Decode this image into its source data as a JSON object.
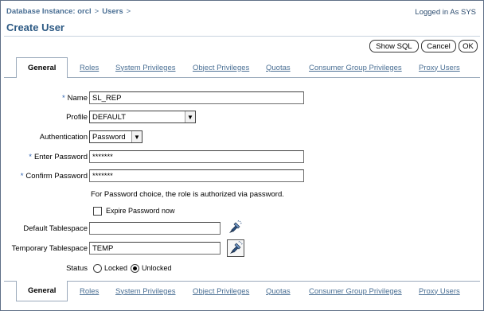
{
  "breadcrumb": {
    "items": [
      "Database Instance: orcl",
      "Users"
    ],
    "separator": ">"
  },
  "login_status": "Logged in As SYS",
  "page_title": "Create User",
  "buttons": {
    "show_sql": "Show SQL",
    "cancel": "Cancel",
    "ok": "OK"
  },
  "tabs": [
    {
      "label": "General",
      "active": true
    },
    {
      "label": "Roles",
      "active": false
    },
    {
      "label": "System Privileges",
      "active": false
    },
    {
      "label": "Object Privileges",
      "active": false
    },
    {
      "label": "Quotas",
      "active": false
    },
    {
      "label": "Consumer Group Privileges",
      "active": false
    },
    {
      "label": "Proxy Users",
      "active": false
    }
  ],
  "form": {
    "required_marker": "*",
    "name": {
      "label": "Name",
      "value": "SL_REP",
      "required": true
    },
    "profile": {
      "label": "Profile",
      "value": "DEFAULT"
    },
    "authentication": {
      "label": "Authentication",
      "value": "Password"
    },
    "enter_password": {
      "label": "Enter Password",
      "value": "*******",
      "required": true
    },
    "confirm_password": {
      "label": "Confirm Password",
      "value": "*******",
      "required": true
    },
    "password_hint": "For Password choice, the role is authorized via password.",
    "expire_password": {
      "label": "Expire Password now",
      "checked": false
    },
    "default_tablespace": {
      "label": "Default Tablespace",
      "value": ""
    },
    "temporary_tablespace": {
      "label": "Temporary Tablespace",
      "value": "TEMP"
    },
    "status": {
      "label": "Status",
      "options": [
        "Locked",
        "Unlocked"
      ],
      "selected": "Unlocked"
    }
  },
  "icons": {
    "dropdown": "chevron-down-icon",
    "search": "flashlight-search-icon"
  },
  "colors": {
    "link": "#4a6f94",
    "title": "#2d5a84",
    "required_marker": "#2a5fb0"
  }
}
